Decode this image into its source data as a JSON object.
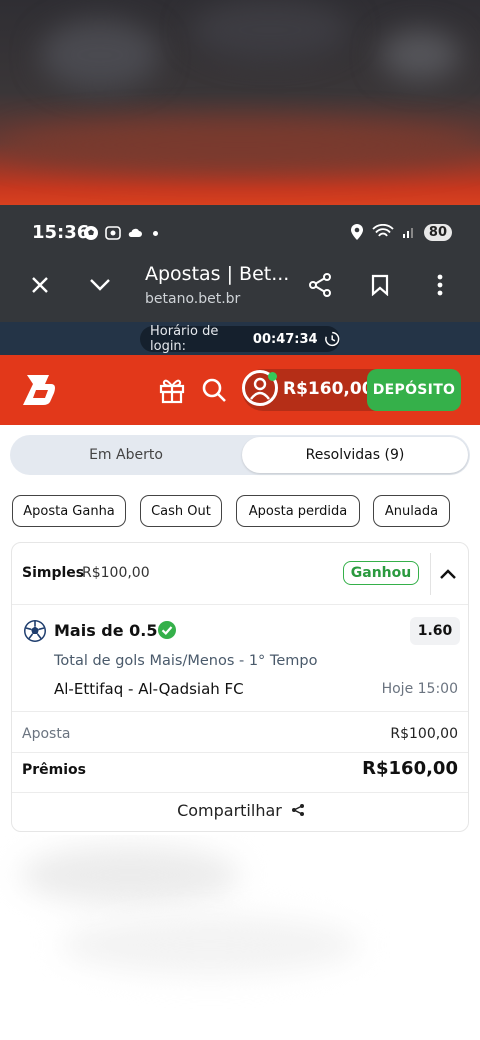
{
  "status_bar": {
    "time": "15:36",
    "battery": "80"
  },
  "browser": {
    "title": "Apostas | Bet...",
    "host": "betano.bet.br"
  },
  "login_timer": {
    "label": "Horário de login:",
    "value": "00:47:34"
  },
  "header": {
    "balance": "R$160,00",
    "deposit_label": "DEPÓSITO"
  },
  "tabs": {
    "open": "Em Aberto",
    "resolved": "Resolvidas (9)"
  },
  "filters": [
    "Aposta Ganha",
    "Cash Out",
    "Aposta perdida",
    "Anulada"
  ],
  "bet": {
    "type": "Simples",
    "stake_header": "R$100,00",
    "status": "Ganhou",
    "selection": "Mais de 0.5",
    "odds": "1.60",
    "market": "Total de gols Mais/Menos - 1° Tempo",
    "match": "Al-Ettifaq - Al-Qadsiah FC",
    "when": "Hoje 15:00",
    "stake_label": "Aposta",
    "stake_value": "R$100,00",
    "prize_label": "Prêmios",
    "prize_value": "R$160,00",
    "share_label": "Compartilhar"
  },
  "colors": {
    "brand": "#e2381a",
    "deposit": "#35b04a",
    "won": "#2a9a3e"
  }
}
